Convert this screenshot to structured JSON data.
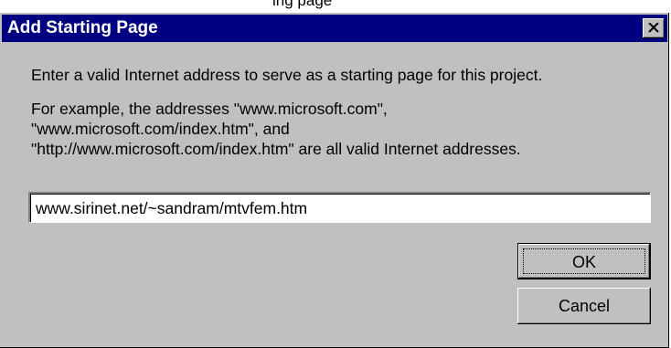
{
  "top_partial_text": "ing page",
  "dialog": {
    "title": "Add Starting Page",
    "close_glyph": "×",
    "instruction": "Enter a valid Internet address to serve as a starting page for this project.",
    "example_lines": [
      "For example, the addresses \"www.microsoft.com\",",
      "\"www.microsoft.com/index.htm\", and",
      "\"http://www.microsoft.com/index.htm\" are all valid Internet addresses."
    ],
    "address_value": "www.sirinet.net/~sandram/mtvfem.htm",
    "ok_label": "OK",
    "cancel_label": "Cancel"
  },
  "colors": {
    "titlebar": "#000080",
    "face": "#c0c0c0"
  }
}
